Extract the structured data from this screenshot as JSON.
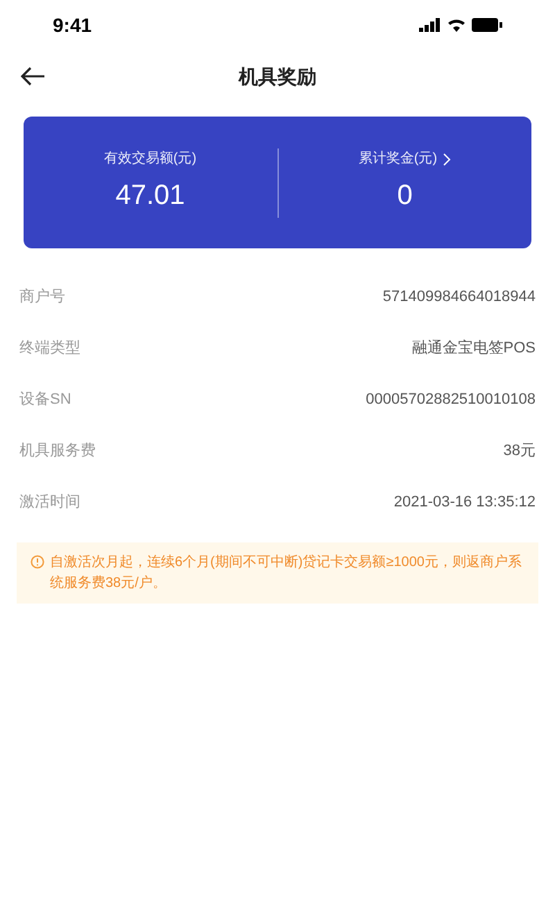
{
  "status_bar": {
    "time": "9:41"
  },
  "header": {
    "title": "机具奖励"
  },
  "summary": [
    {
      "label": "有效交易额(元)",
      "value": "47.01",
      "has_arrow": false
    },
    {
      "label": "累计奖金(元)",
      "value": "0",
      "has_arrow": true
    }
  ],
  "details": [
    {
      "label": "商户号",
      "value": "571409984664018944"
    },
    {
      "label": "终端类型",
      "value": "融通金宝电签POS"
    },
    {
      "label": "设备SN",
      "value": "00005702882510010108"
    },
    {
      "label": "机具服务费",
      "value": "38元"
    },
    {
      "label": "激活时间",
      "value": "2021-03-16 13:35:12"
    }
  ],
  "notice": {
    "text": "自激活次月起，连续6个月(期间不可中断)贷记卡交易额≥1000元，则返商户系统服务费38元/户。"
  }
}
